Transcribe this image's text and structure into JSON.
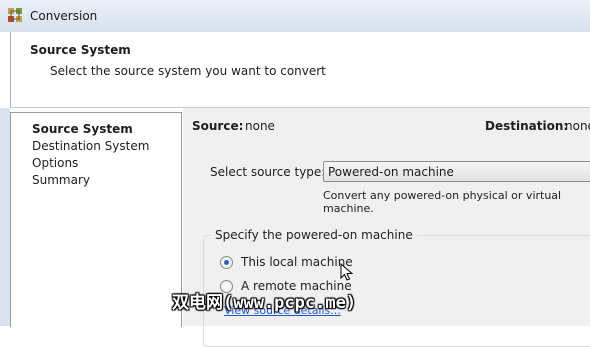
{
  "window": {
    "title": "Conversion",
    "icon": "vmware-converter-icon"
  },
  "header": {
    "title": "Source System",
    "subtitle": "Select the source system you want to convert"
  },
  "nav": {
    "items": [
      {
        "label": "Source System",
        "active": true
      },
      {
        "label": "Destination System",
        "active": false
      },
      {
        "label": "Options",
        "active": false
      },
      {
        "label": "Summary",
        "active": false
      }
    ]
  },
  "main": {
    "source_label": "Source:",
    "source_value": "none",
    "destination_label": "Destination:",
    "destination_value": "none",
    "select_source_type_label": "Select source type:",
    "source_type_value": "Powered-on machine",
    "source_type_help": "Convert any powered-on physical or virtual machine.",
    "group_title": "Specify the powered-on machine",
    "radio_local": {
      "label": "This local machine",
      "checked": true
    },
    "radio_remote": {
      "label": "A remote machine",
      "checked": false
    },
    "view_details_link": "View source details..."
  },
  "watermark": "双电网(www.pcpc.me)",
  "colors": {
    "accent": "#2a62b8",
    "link": "#2255cc",
    "panel_bg": "#f0f0f0"
  }
}
